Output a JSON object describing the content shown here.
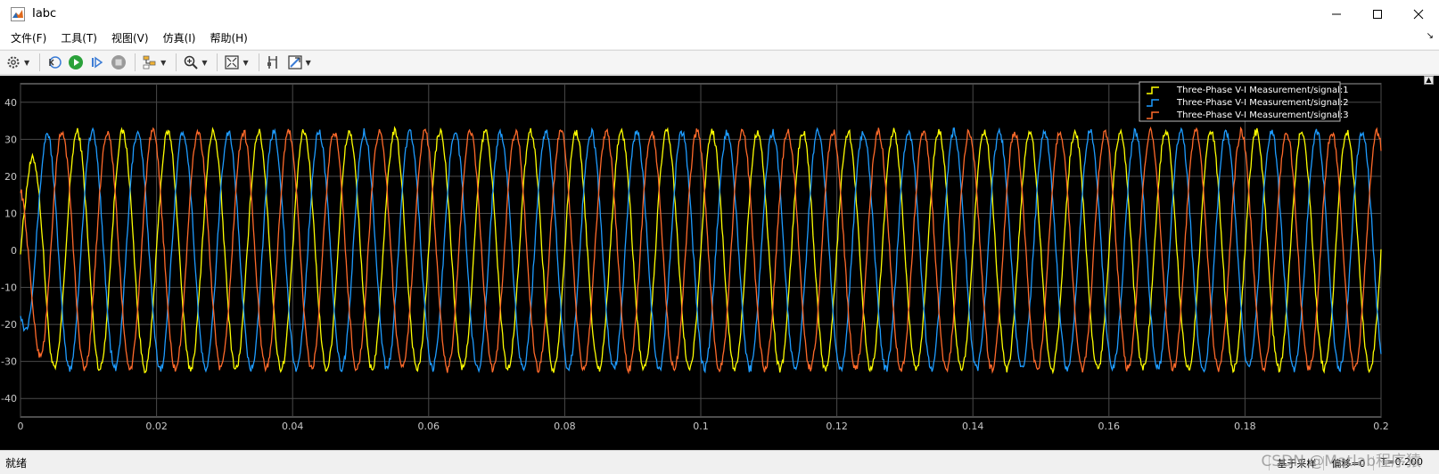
{
  "window": {
    "title": "Iabc",
    "icon": "matlab-logo-icon",
    "controls": [
      "minimize-icon",
      "maximize-icon",
      "close-icon"
    ]
  },
  "menu": [
    "文件(F)",
    "工具(T)",
    "视图(V)",
    "仿真(I)",
    "帮助(H)"
  ],
  "toolbar": {
    "buttons": [
      "settings-icon",
      "step-back-icon",
      "run-icon",
      "step-forward-icon",
      "stop-icon",
      "highlight-icon",
      "zoom-in-icon",
      "fit-to-view-icon",
      "cursor-measurement-icon",
      "triggers-icon"
    ]
  },
  "status": {
    "left": "就绪",
    "sample": "基于采样",
    "offset": "偏移=0",
    "time": "T=0.200"
  },
  "watermark": "CSDN @Matlab程序猿",
  "colors": {
    "plot_background": "#000000",
    "axes_background": "#000000",
    "grid": "#4a4a4a",
    "tick_label": "#c8c8c8",
    "series1": "#ffff00",
    "series2": "#1e9cff",
    "series3": "#ff6a2a"
  },
  "chart_data": {
    "type": "line",
    "title": "",
    "xlabel": "",
    "ylabel": "",
    "xlim": [
      0,
      0.2
    ],
    "ylim": [
      -45,
      45
    ],
    "xticks": [
      0,
      0.02,
      0.04,
      0.06,
      0.08,
      0.1,
      0.12,
      0.14,
      0.16,
      0.18,
      0.2
    ],
    "xtick_labels": [
      "0",
      "0.02",
      "0.04",
      "0.06",
      "0.08",
      "0.1",
      "0.12",
      "0.14",
      "0.16",
      "0.18",
      "0.2"
    ],
    "yticks": [
      40,
      30,
      20,
      10,
      0,
      -10,
      -20,
      -30,
      -40
    ],
    "ytick_labels": [
      "40",
      "30",
      "20",
      "10",
      "0",
      "-10",
      "-20",
      "-30",
      "-40"
    ],
    "grid": true,
    "legend_position": "top-right",
    "frequency_hz": 150,
    "series": [
      {
        "name": "Three-Phase V-I Measurement/signal:1",
        "color": "#ffff00",
        "amplitude": 32,
        "phase_deg": 0
      },
      {
        "name": "Three-Phase V-I Measurement/signal:2",
        "color": "#1e9cff",
        "amplitude": 32,
        "phase_deg": -120
      },
      {
        "name": "Three-Phase V-I Measurement/signal:3",
        "color": "#ff6a2a",
        "amplitude": 32,
        "phase_deg": 120
      }
    ]
  }
}
